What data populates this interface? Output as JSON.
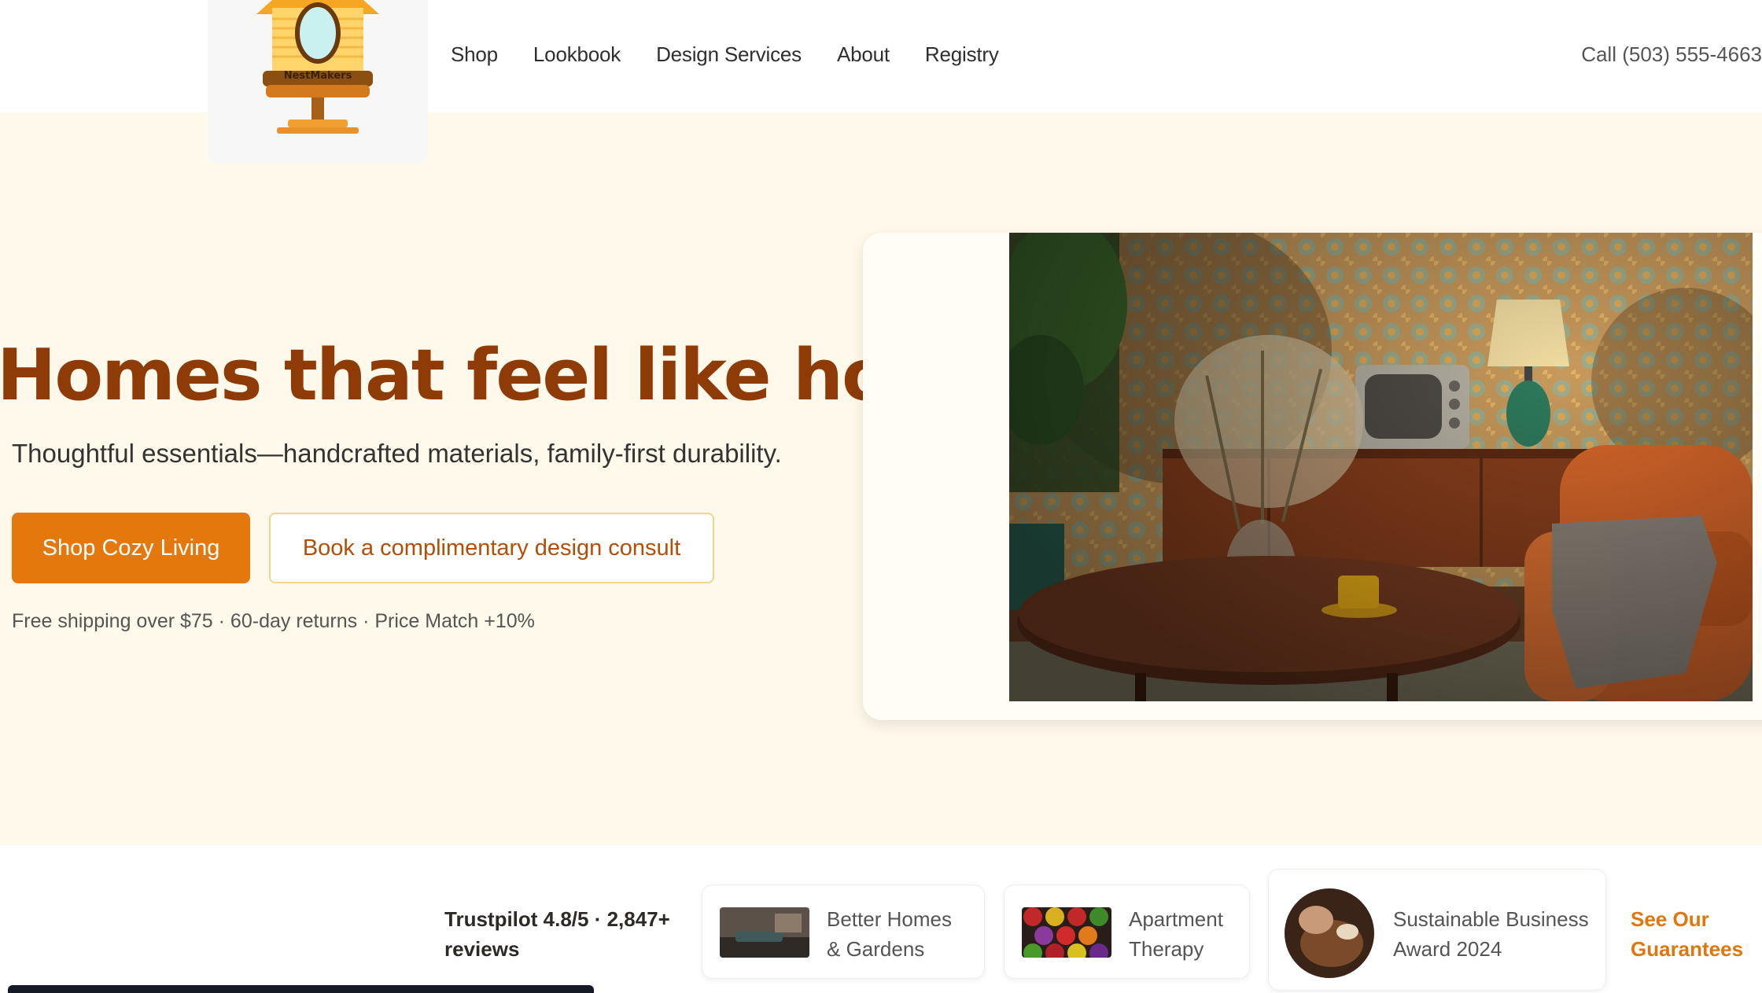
{
  "brand": {
    "logo_text": "NestMakers"
  },
  "nav": {
    "items": [
      {
        "label": "Shop"
      },
      {
        "label": "Lookbook"
      },
      {
        "label": "Design Services"
      },
      {
        "label": "About"
      },
      {
        "label": "Registry"
      }
    ],
    "phone": "Call (503) 555-4663"
  },
  "hero": {
    "title": "Homes that feel like home.",
    "subtitle": "Thoughtful essentials—handcrafted materials, family-first durability.",
    "primary_cta": "Shop Cozy Living",
    "secondary_cta": "Book a complimentary design consult",
    "note": "Free shipping over $75 · 60-day returns · Price Match +10%"
  },
  "trust": {
    "rating_line1": "Trustpilot 4.8/5 · 2,847+",
    "rating_line2": "reviews",
    "press": [
      {
        "line1": "Better Homes",
        "line2": "& Gardens"
      },
      {
        "line1": "Apartment",
        "line2": "Therapy"
      },
      {
        "line1": "Sustainable Business",
        "line2": "Award 2024"
      }
    ],
    "link_line1": "See Our",
    "link_line2": "Guarantees"
  },
  "colors": {
    "accent": "#e5780c",
    "headline": "#8e3b08",
    "hero_bg": "#fff9eb"
  }
}
